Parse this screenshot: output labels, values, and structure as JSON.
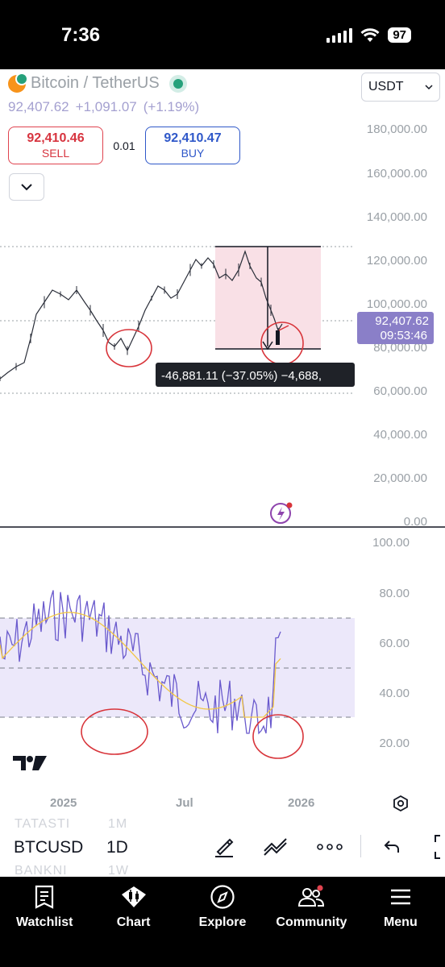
{
  "status_bar": {
    "time": "7:36",
    "battery": "97"
  },
  "symbol_header": {
    "title": "Bitcoin / TetherUS",
    "last_price": "92,407.62",
    "change": "+1,091.07",
    "change_pct": "(+1.19%)",
    "currency": "USDT"
  },
  "trade": {
    "sell_price": "92,410.46",
    "sell_label": "SELL",
    "spread": "0.01",
    "buy_price": "92,410.47",
    "buy_label": "BUY"
  },
  "price_axis": {
    "ticks": [
      "180,000.00",
      "160,000.00",
      "140,000.00",
      "120,000.00",
      "100,000.00",
      "80,000.00",
      "60,000.00",
      "40,000.00",
      "20,000.00",
      "0.00"
    ]
  },
  "price_badge": {
    "price": "92,407.62",
    "countdown": "09:53:46"
  },
  "measure_tooltip": {
    "text": "-46,881.11 (−37.05%) −4,688,"
  },
  "rsi_axis": {
    "ticks": [
      "100.00",
      "80.00",
      "60.00",
      "40.00",
      "20.00"
    ]
  },
  "time_axis": {
    "labels": [
      "2025",
      "Jul",
      "2026"
    ]
  },
  "toolbar": {
    "symbol": "BTCUSD",
    "timeframe": "1D",
    "ghost_top_symbol": "TATASTI",
    "ghost_top_tf": "1M",
    "ghost_bottom_symbol": "BANKNI",
    "ghost_bottom_tf": "1W"
  },
  "nav": {
    "items": [
      {
        "label": "Watchlist",
        "icon": "watchlist-icon"
      },
      {
        "label": "Chart",
        "icon": "chart-icon"
      },
      {
        "label": "Explore",
        "icon": "compass-icon"
      },
      {
        "label": "Community",
        "icon": "community-icon"
      },
      {
        "label": "Menu",
        "icon": "menu-icon"
      }
    ]
  },
  "colors": {
    "sell": "#d7343f",
    "buy": "#2f58c9",
    "rsi_line": "#6a5acd",
    "rsi_ma": "#f2c744",
    "badge": "#8a7fc8",
    "annotation": "#d8343a"
  }
}
